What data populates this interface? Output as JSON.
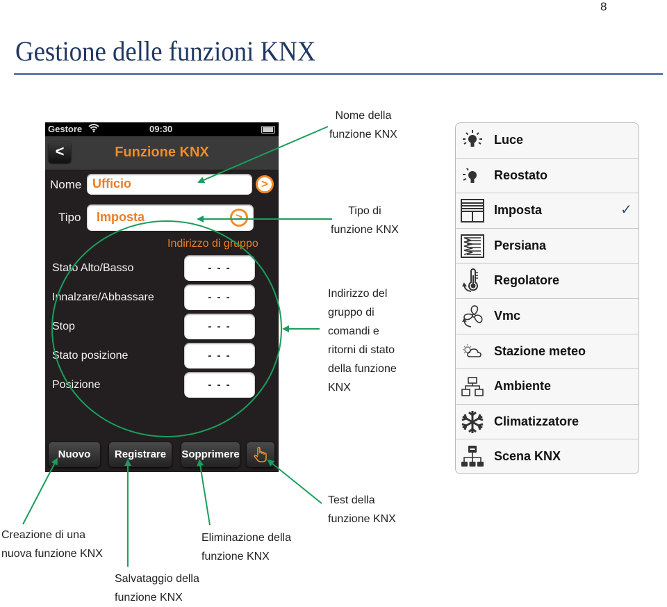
{
  "page": {
    "number": "8",
    "title": "Gestione delle funzioni KNX"
  },
  "phone": {
    "status_bar": {
      "carrier": "Gestore",
      "wifi_icon": "wifi-icon",
      "time": "09:30",
      "battery_icon": "battery-icon"
    },
    "nav": {
      "back_icon": "chevron-left-icon",
      "back_glyph": "<",
      "title": "Funzione KNX"
    },
    "form": {
      "name_label": "Nome",
      "name_value": "Ufficio",
      "type_label": "Tipo",
      "type_value": "Imposta",
      "arrow_glyph": ">",
      "group_header": "Indirizzo di gruppo",
      "addresses": [
        {
          "label": "Stato Alto/Basso",
          "value": "- - -"
        },
        {
          "label": "Innalzare/Abbassare",
          "value": "- - -"
        },
        {
          "label": "Stop",
          "value": "- - -"
        },
        {
          "label": "Stato posizione",
          "value": "- - -"
        },
        {
          "label": "Posizione",
          "value": "- - -"
        }
      ]
    },
    "toolbar": {
      "new_label": "Nuovo",
      "save_label": "Registrare",
      "delete_label": "Sopprimere",
      "test_icon": "hand-pointer-icon",
      "test_glyph": "☝"
    }
  },
  "type_list": {
    "items": [
      {
        "label": "Luce",
        "icon": "light-bulb-icon",
        "selected": false
      },
      {
        "label": "Reostato",
        "icon": "dimmer-bulb-icon",
        "selected": false
      },
      {
        "label": "Imposta",
        "icon": "shutter-icon",
        "selected": true
      },
      {
        "label": "Persiana",
        "icon": "blind-icon",
        "selected": false
      },
      {
        "label": "Regolatore",
        "icon": "thermometer-icon",
        "selected": false
      },
      {
        "label": "Vmc",
        "icon": "fan-icon",
        "selected": false
      },
      {
        "label": "Stazione meteo",
        "icon": "weather-icon",
        "selected": false
      },
      {
        "label": "Ambiente",
        "icon": "rooms-icon",
        "selected": false
      },
      {
        "label": "Climatizzatore",
        "icon": "snowflake-icon",
        "selected": false
      },
      {
        "label": "Scena KNX",
        "icon": "scene-network-icon",
        "selected": false
      }
    ],
    "check_glyph": "✓"
  },
  "annotations": {
    "name": "Nome della\nfunzione KNX",
    "type": "Tipo di\nfunzione KNX",
    "group": "Indirizzo del\ngruppo di\ncomandi e\nritorni di stato\ndella funzione\nKNX",
    "new": "Creazione di una\nnuova funzione KNX",
    "save": "Salvataggio della\nfunzione KNX",
    "delete": "Eliminazione della\nfunzione KNX",
    "test": "Test della\nfunzione KNX"
  },
  "colors": {
    "accent_orange": "#f08c28",
    "annotation_green": "#1a9e5c",
    "title_blue": "#1f3864"
  }
}
